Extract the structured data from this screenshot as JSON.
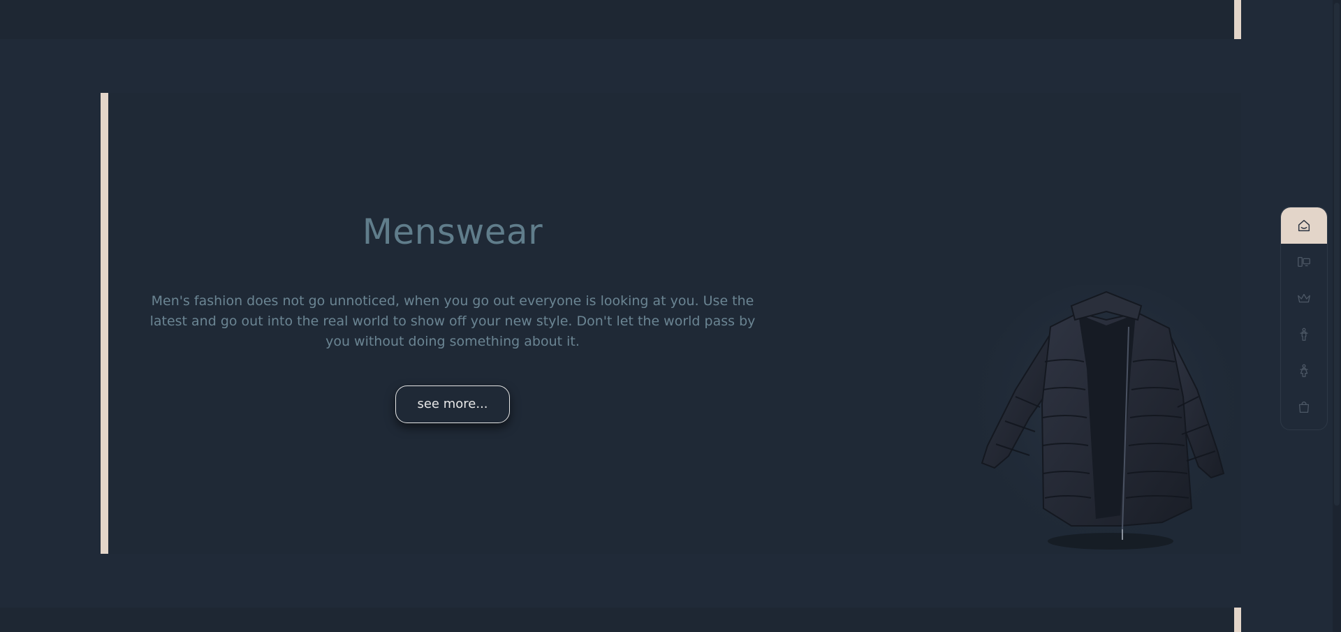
{
  "hero": {
    "title": "Menswear",
    "description": "Men's fashion does not go unnoticed, when you go out everyone is looking at you. Use the latest and go out into the real world to show off your new style. Don't let the world pass by you without doing something about it.",
    "cta_label": "see more..."
  },
  "side_nav": {
    "items": [
      {
        "icon": "home-icon",
        "active": true
      },
      {
        "icon": "devices-icon",
        "active": false
      },
      {
        "icon": "crown-icon",
        "active": false
      },
      {
        "icon": "man-icon",
        "active": false
      },
      {
        "icon": "woman-icon",
        "active": false
      },
      {
        "icon": "shopping-bag-icon",
        "active": false
      }
    ]
  },
  "colors": {
    "background": "#202a38",
    "accent": "#e3d5c9",
    "title": "#607d8b",
    "text": "#6b8593"
  }
}
